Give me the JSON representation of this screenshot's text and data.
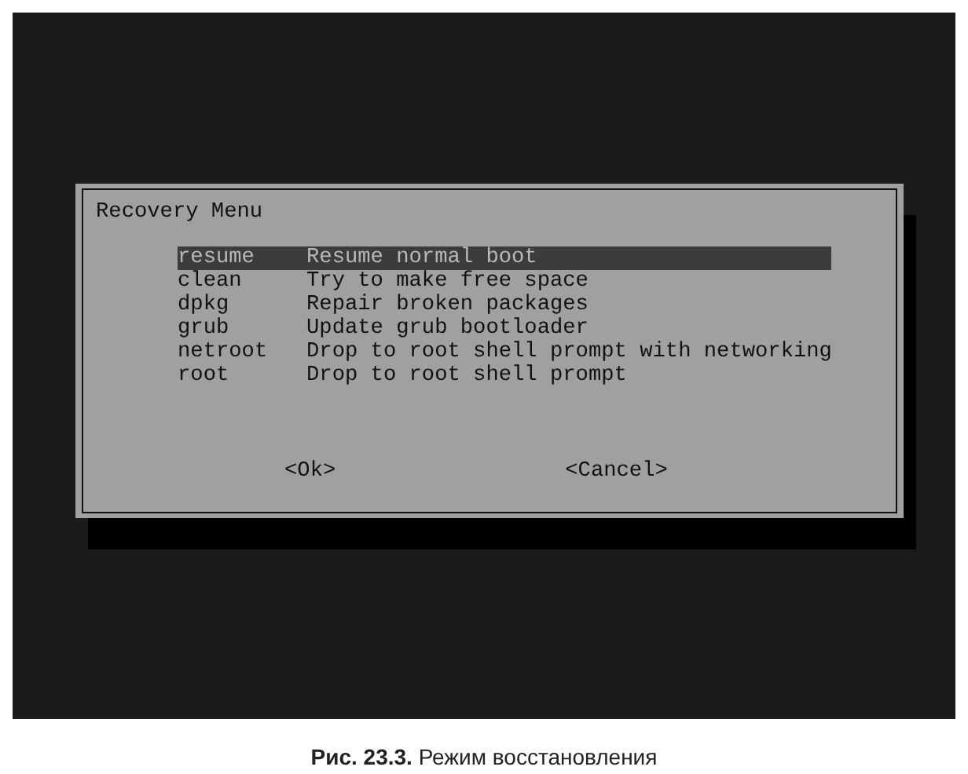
{
  "dialog": {
    "title": "Recovery Menu",
    "items": [
      {
        "tag": "resume",
        "description": "Resume normal boot",
        "selected": true
      },
      {
        "tag": "clean",
        "description": "Try to make free space",
        "selected": false
      },
      {
        "tag": "dpkg",
        "description": "Repair broken packages",
        "selected": false
      },
      {
        "tag": "grub",
        "description": "Update grub bootloader",
        "selected": false
      },
      {
        "tag": "netroot",
        "description": "Drop to root shell prompt with networking",
        "selected": false
      },
      {
        "tag": "root",
        "description": "Drop to root shell prompt",
        "selected": false
      }
    ],
    "buttons": [
      "<Ok>",
      "<Cancel>"
    ]
  },
  "caption": "**Рис. 23.3.** Режим восстановления"
}
